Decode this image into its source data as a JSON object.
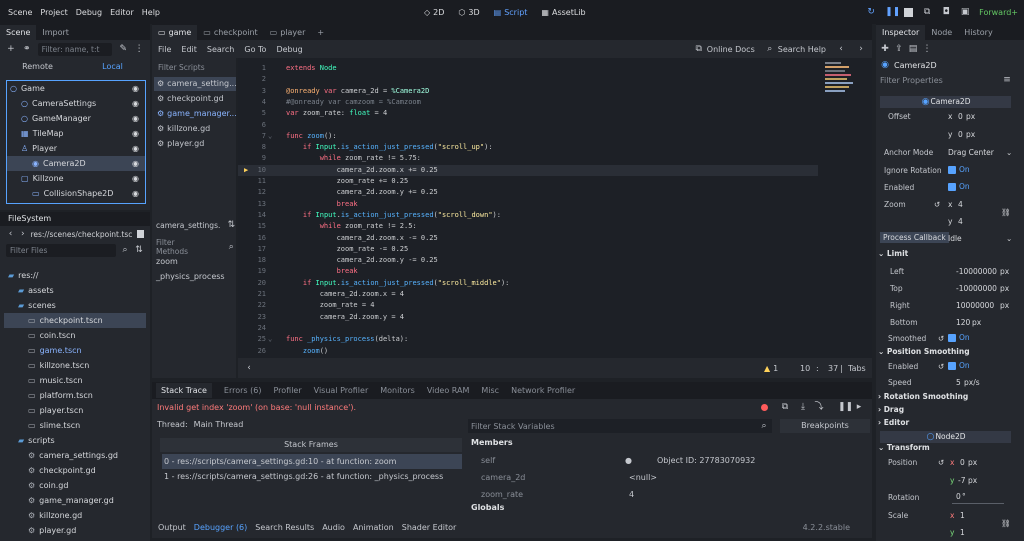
{
  "menus": [
    "Scene",
    "Project",
    "Debug",
    "Editor",
    "Help"
  ],
  "workspaces": [
    {
      "icon": "2d-icon",
      "label": "2D",
      "active": false
    },
    {
      "icon": "3d-icon",
      "label": "3D",
      "active": false
    },
    {
      "icon": "script-icon",
      "label": "Script",
      "active": true
    },
    {
      "icon": "assetlib-icon",
      "label": "AssetLib",
      "active": false
    }
  ],
  "renderer": "Forward+",
  "scene_dock": {
    "tabs": [
      "Scene",
      "Import"
    ],
    "filter_placeholder": "Filter: name, t:t",
    "remote_label": "Remote",
    "local_label": "Local",
    "tree": [
      {
        "label": "Game",
        "depth": 0,
        "icon": "node-icon"
      },
      {
        "label": "CameraSettings",
        "depth": 1,
        "icon": "node-icon"
      },
      {
        "label": "GameManager",
        "depth": 1,
        "icon": "node-icon"
      },
      {
        "label": "TileMap",
        "depth": 1,
        "icon": "tilemap-icon"
      },
      {
        "label": "Player",
        "depth": 1,
        "icon": "player-icon"
      },
      {
        "label": "Camera2D",
        "depth": 2,
        "icon": "camera2d-icon",
        "selected": true
      },
      {
        "label": "Killzone",
        "depth": 1,
        "icon": "area2d-icon"
      },
      {
        "label": "CollisionShape2D",
        "depth": 2,
        "icon": "collision-icon"
      }
    ]
  },
  "filesystem": {
    "title": "FileSystem",
    "path": "res://scenes/checkpoint.tsc",
    "filter_placeholder": "Filter Files",
    "items": [
      {
        "label": "res://",
        "depth": 0,
        "type": "folder"
      },
      {
        "label": "assets",
        "depth": 1,
        "type": "folder"
      },
      {
        "label": "scenes",
        "depth": 1,
        "type": "folder"
      },
      {
        "label": "checkpoint.tscn",
        "depth": 2,
        "type": "scene",
        "selected": true
      },
      {
        "label": "coin.tscn",
        "depth": 2,
        "type": "scene"
      },
      {
        "label": "game.tscn",
        "depth": 2,
        "type": "scene",
        "highlight": true
      },
      {
        "label": "killzone.tscn",
        "depth": 2,
        "type": "scene"
      },
      {
        "label": "music.tscn",
        "depth": 2,
        "type": "scene"
      },
      {
        "label": "platform.tscn",
        "depth": 2,
        "type": "scene"
      },
      {
        "label": "player.tscn",
        "depth": 2,
        "type": "scene"
      },
      {
        "label": "slime.tscn",
        "depth": 2,
        "type": "scene"
      },
      {
        "label": "scripts",
        "depth": 1,
        "type": "folder"
      },
      {
        "label": "camera_settings.gd",
        "depth": 2,
        "type": "script"
      },
      {
        "label": "checkpoint.gd",
        "depth": 2,
        "type": "script"
      },
      {
        "label": "coin.gd",
        "depth": 2,
        "type": "script"
      },
      {
        "label": "game_manager.gd",
        "depth": 2,
        "type": "script"
      },
      {
        "label": "killzone.gd",
        "depth": 2,
        "type": "script"
      },
      {
        "label": "player.gd",
        "depth": 2,
        "type": "script"
      }
    ]
  },
  "scene_tabs": [
    {
      "label": "game",
      "active": true
    },
    {
      "label": "checkpoint",
      "active": false
    },
    {
      "label": "player",
      "active": false
    }
  ],
  "script_menu": [
    "File",
    "Edit",
    "Search",
    "Go To",
    "Debug"
  ],
  "online_docs": "Online Docs",
  "search_help": "Search Help",
  "filter_scripts": "Filter Scripts",
  "scripts_list": [
    {
      "label": "camera_setting...",
      "active": true
    },
    {
      "label": "checkpoint.gd",
      "active": false
    },
    {
      "label": "game_manager...",
      "active": false,
      "highlight": true
    },
    {
      "label": "killzone.gd",
      "active": false
    },
    {
      "label": "player.gd",
      "active": false
    }
  ],
  "current_script_short": "camera_settings.",
  "filter_methods": "Filter Methods",
  "methods": [
    "zoom",
    "_physics_process"
  ],
  "code": [
    {
      "n": "1",
      "t": "extends Node"
    },
    {
      "n": "2",
      "t": ""
    },
    {
      "n": "3",
      "t": "@onready var camera_2d = %Camera2D"
    },
    {
      "n": "4",
      "t": "#@onready var camzoom = %Camzoom"
    },
    {
      "n": "5",
      "t": "var zoom_rate: float = 4"
    },
    {
      "n": "6",
      "t": ""
    },
    {
      "n": "7",
      "t": "func zoom():"
    },
    {
      "n": "8",
      "t": "\tif Input.is_action_just_pressed(\"scroll_up\"):"
    },
    {
      "n": "9",
      "t": "\t\twhile zoom_rate != 5.75:"
    },
    {
      "n": "10",
      "t": "\t\t\tcamera_2d.zoom.x += 0.25"
    },
    {
      "n": "11",
      "t": "\t\t\tzoom_rate += 0.25"
    },
    {
      "n": "12",
      "t": "\t\t\tcamera_2d.zoom.y += 0.25"
    },
    {
      "n": "13",
      "t": "\t\t\tbreak"
    },
    {
      "n": "14",
      "t": "\tif Input.is_action_just_pressed(\"scroll_down\"):"
    },
    {
      "n": "15",
      "t": "\t\twhile zoom_rate != 2.5:"
    },
    {
      "n": "16",
      "t": "\t\t\tcamera_2d.zoom.x -= 0.25"
    },
    {
      "n": "17",
      "t": "\t\t\tzoom_rate -= 0.25"
    },
    {
      "n": "18",
      "t": "\t\t\tcamera_2d.zoom.y -= 0.25"
    },
    {
      "n": "19",
      "t": "\t\t\tbreak"
    },
    {
      "n": "20",
      "t": "\tif Input.is_action_just_pressed(\"scroll_middle\"):"
    },
    {
      "n": "21",
      "t": "\t\tcamera_2d.zoom.x = 4"
    },
    {
      "n": "22",
      "t": "\t\tzoom_rate = 4"
    },
    {
      "n": "23",
      "t": "\t\tcamera_2d.zoom.y = 4"
    },
    {
      "n": "24",
      "t": ""
    },
    {
      "n": "25",
      "t": "func _physics_process(delta):"
    },
    {
      "n": "26",
      "t": "\tzoom()"
    }
  ],
  "status": {
    "warnings": "1",
    "line": "10",
    "col": "37",
    "indent": "Tabs"
  },
  "bottom_tabs": [
    "Stack Trace",
    "Errors (6)",
    "Profiler",
    "Visual Profiler",
    "Monitors",
    "Video RAM",
    "Misc",
    "Network Profiler"
  ],
  "error_text": "Invalid get index 'zoom' (on base: 'null instance').",
  "thread_label": "Thread:",
  "thread_value": "Main Thread",
  "stack_header": "Stack Frames",
  "stack_frames": [
    "0 - res://scripts/camera_settings.gd:10 - at function: zoom",
    "1 - res://scripts/camera_settings.gd:26 - at function: _physics_process"
  ],
  "filter_stack": "Filter Stack Variables",
  "members_header": "Members",
  "variables": [
    {
      "name": "self",
      "value": "Object ID: 27783070932"
    },
    {
      "name": "camera_2d",
      "value": "<null>"
    },
    {
      "name": "zoom_rate",
      "value": "4"
    }
  ],
  "globals_header": "Globals",
  "breakpoints": "Breakpoints",
  "bottom_bar": [
    "Output",
    "Debugger (6)",
    "Search Results",
    "Audio",
    "Animation",
    "Shader Editor"
  ],
  "version": "4.2.2.stable",
  "inspector": {
    "tabs": [
      "Inspector",
      "Node",
      "History"
    ],
    "object": "Camera2D",
    "filter_placeholder": "Filter Properties",
    "class_header": "Camera2D",
    "offset_label": "Offset",
    "offset_x": "0",
    "offset_y": "0",
    "px": "px",
    "anchor_label": "Anchor Mode",
    "anchor_value": "Drag Center",
    "ignore_rot_label": "Ignore Rotation",
    "on": "On",
    "enabled_label": "Enabled",
    "zoom_label": "Zoom",
    "zoom_x": "4",
    "zoom_y": "4",
    "process_label": "Process Callback",
    "process_value": "Idle",
    "limit_header": "Limit",
    "limits": [
      {
        "label": "Left",
        "value": "-10000000"
      },
      {
        "label": "Top",
        "value": "-10000000"
      },
      {
        "label": "Right",
        "value": "10000000"
      },
      {
        "label": "Bottom",
        "value": "120"
      }
    ],
    "smoothed_label": "Smoothed",
    "pos_smooth_header": "Position Smoothing",
    "ps_enabled_label": "Enabled",
    "speed_label": "Speed",
    "speed_value": "5",
    "speed_unit": "px/s",
    "rot_smooth": "Rotation Smoothing",
    "drag": "Drag",
    "editor": "Editor",
    "node2d_header": "Node2D",
    "transform_header": "Transform",
    "position_label": "Position",
    "pos_x": "0",
    "pos_y": "-7",
    "rotation_label": "Rotation",
    "rotation_value": "0",
    "degree": "°",
    "scale_label": "Scale",
    "scale_x": "1",
    "scale_y": "1",
    "x": "x",
    "y": "y"
  },
  "colors": {
    "accent": "#57a3ff",
    "error": "#ff7b7b",
    "warning": "#ffd25a"
  }
}
